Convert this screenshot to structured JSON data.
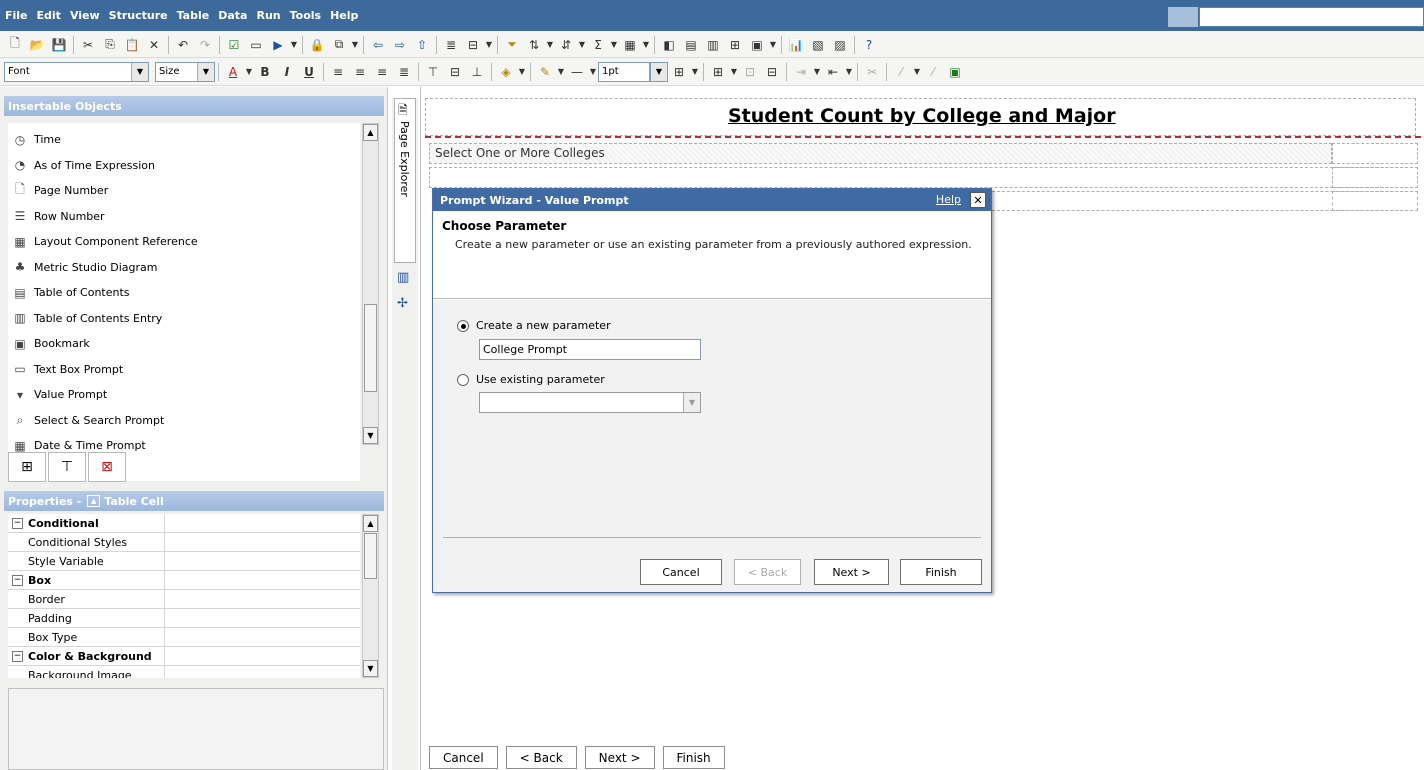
{
  "menu": [
    "File",
    "Edit",
    "View",
    "Structure",
    "Table",
    "Data",
    "Run",
    "Tools",
    "Help"
  ],
  "toolbar2": {
    "font_value": "Font",
    "size_value": "Size",
    "line_width_value": "1pt"
  },
  "insertable": {
    "header": "Insertable Objects",
    "items": [
      {
        "label": "Time",
        "icon": "clock-icon"
      },
      {
        "label": "As of Time Expression",
        "icon": "as-of-time-icon"
      },
      {
        "label": "Page Number",
        "icon": "page-number-icon"
      },
      {
        "label": "Row Number",
        "icon": "row-number-icon"
      },
      {
        "label": "Layout Component Reference",
        "icon": "layout-reference-icon"
      },
      {
        "label": "Metric Studio Diagram",
        "icon": "metric-diagram-icon"
      },
      {
        "label": "Table of Contents",
        "icon": "toc-icon"
      },
      {
        "label": "Table of Contents Entry",
        "icon": "toc-entry-icon"
      },
      {
        "label": "Bookmark",
        "icon": "bookmark-icon"
      },
      {
        "label": "Text Box Prompt",
        "icon": "text-box-prompt-icon"
      },
      {
        "label": "Value Prompt",
        "icon": "value-prompt-icon"
      },
      {
        "label": "Select & Search Prompt",
        "icon": "select-search-prompt-icon"
      },
      {
        "label": "Date & Time Prompt",
        "icon": "date-time-prompt-icon"
      }
    ]
  },
  "properties": {
    "header_prefix": "Properties -",
    "header_object": "Table Cell",
    "rows": [
      {
        "label": "Conditional",
        "group": true
      },
      {
        "label": "Conditional Styles",
        "group": false
      },
      {
        "label": "Style Variable",
        "group": false
      },
      {
        "label": "Box",
        "group": true
      },
      {
        "label": "Border",
        "group": false
      },
      {
        "label": "Padding",
        "group": false
      },
      {
        "label": "Box Type",
        "group": false
      },
      {
        "label": "Color & Background",
        "group": true
      },
      {
        "label": "Background Image",
        "group": false
      }
    ]
  },
  "explorer": {
    "label": "Page Explorer"
  },
  "report": {
    "title": "Student Count by College and Major",
    "prompt_label": "Select One or More Colleges"
  },
  "dialog": {
    "title": "Prompt Wizard - Value Prompt",
    "help": "Help",
    "close": "✕",
    "heading": "Choose Parameter",
    "description": "Create a new parameter or use an existing parameter from a previously authored expression.",
    "option_new": "Create a new parameter",
    "param_value": "College Prompt",
    "option_existing": "Use existing parameter",
    "existing_value": "",
    "buttons": {
      "cancel": "Cancel",
      "back": "< Back",
      "next": "Next >",
      "finish": "Finish"
    }
  },
  "bottom_nav": {
    "cancel": "Cancel",
    "back": "< Back",
    "next": "Next >",
    "finish": "Finish"
  },
  "colors": {
    "menubar": "#3d6a9b",
    "dialog_title": "#3f6aa3",
    "accent_red": "#b03030"
  }
}
